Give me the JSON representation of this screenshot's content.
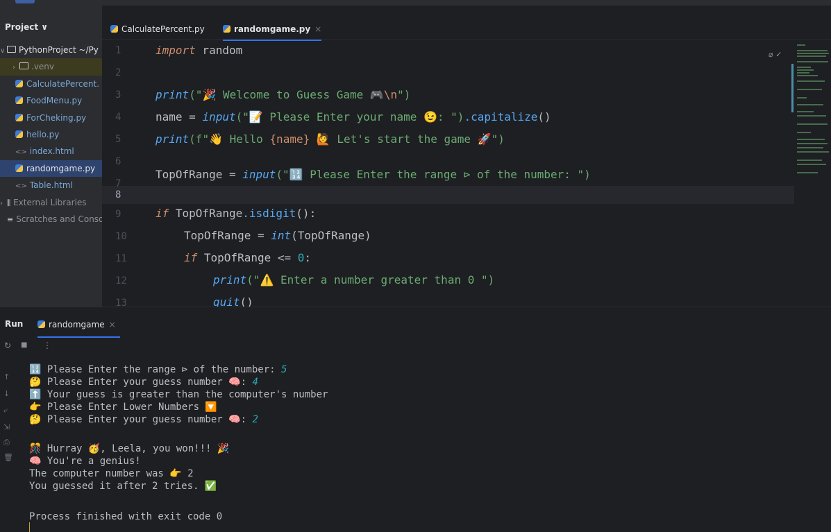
{
  "project": {
    "title": "Project ∨",
    "items": [
      {
        "label": "PythonProject ~/Py",
        "kind": "root"
      },
      {
        "label": ".venv",
        "kind": "folder"
      },
      {
        "label": "CalculatePercent.",
        "kind": "py"
      },
      {
        "label": "FoodMenu.py",
        "kind": "py"
      },
      {
        "label": "ForCheking.py",
        "kind": "py"
      },
      {
        "label": "hello.py",
        "kind": "py"
      },
      {
        "label": "index.html",
        "kind": "html"
      },
      {
        "label": "randomgame.py",
        "kind": "py"
      },
      {
        "label": "Table.html",
        "kind": "html"
      },
      {
        "label": "External Libraries",
        "kind": "lib"
      },
      {
        "label": "Scratches and Conso",
        "kind": "scratch"
      }
    ]
  },
  "editor": {
    "tabs": [
      {
        "label": "CalculatePercent.py"
      },
      {
        "label": "randomgame.py",
        "close": "×"
      }
    ],
    "line_numbers": [
      "1",
      "2",
      "3",
      "4",
      "5",
      "6",
      "7",
      "8",
      "9",
      "10",
      "11",
      "12",
      "13"
    ],
    "code": {
      "l1_kw": "import",
      "l1_rest": " random",
      "l3_fn": "print",
      "l3_str": "(\"🎉 Welcome to Guess Game 🎮",
      "l3_esc": "\\n",
      "l3_end": "\")",
      "l4_a": "name = ",
      "l4_fn": "input",
      "l4_str": "(\"📝 Please Enter your name 😉: \")",
      "l4_meth": ".capitalize",
      "l4_end": "()",
      "l5_fn": "print",
      "l5_a": "(f\"👋 Hello ",
      "l5_b": "{name}",
      "l5_c": " 🙋 Let's start the game 🚀\")",
      "l7_a": "TopOfRange = ",
      "l7_fn": "input",
      "l7_str": "(\"🔢 Please Enter the range ⊳ of the number: \")",
      "l9_kw": "if",
      "l9_a": " TopOfRange",
      "l9_meth": ".isdigit",
      "l9_end": "():",
      "l10_a": "TopOfRange = ",
      "l10_fn": "int",
      "l10_end": "(TopOfRange)",
      "l11_kw": "if",
      "l11_a": " TopOfRange <= ",
      "l11_num": "0",
      "l11_end": ":",
      "l12_fn": "print",
      "l12_str": "(\"⚠️ Enter a number greater than 0 \")",
      "l13_fn": "quit",
      "l13_end": "()"
    },
    "status_icons": "⌀ ✓"
  },
  "run": {
    "title": "Run",
    "tab_label": "randomgame",
    "tab_close": "×",
    "toolbar": {
      "rerun": "↻",
      "stop": "■",
      "more": "⋮"
    },
    "console": [
      {
        "text": "🔢 Please Enter the range ⊳ of the number: ",
        "input": "5"
      },
      {
        "text": "🤔 Please Enter your guess number 🧠: ",
        "input": "4"
      },
      {
        "text": "⬆️ Your guess is greater than the computer's number",
        "input": ""
      },
      {
        "text": "👉 Please Enter Lower Numbers 🔽",
        "input": ""
      },
      {
        "text": "🤔 Please Enter your guess number 🧠: ",
        "input": "2"
      },
      {
        "text": "",
        "input": ""
      },
      {
        "text": "🎊 Hurray 🥳, Leela, you won!!! 🎉",
        "input": ""
      },
      {
        "text": "🧠 You're a genius!",
        "input": ""
      },
      {
        "text": "The computer number was 👉 2",
        "input": ""
      },
      {
        "text": "You guessed it after 2 tries. ✅",
        "input": ""
      },
      {
        "text": "",
        "input": ""
      },
      {
        "text": "Process finished with exit code 0",
        "input": ""
      }
    ]
  }
}
